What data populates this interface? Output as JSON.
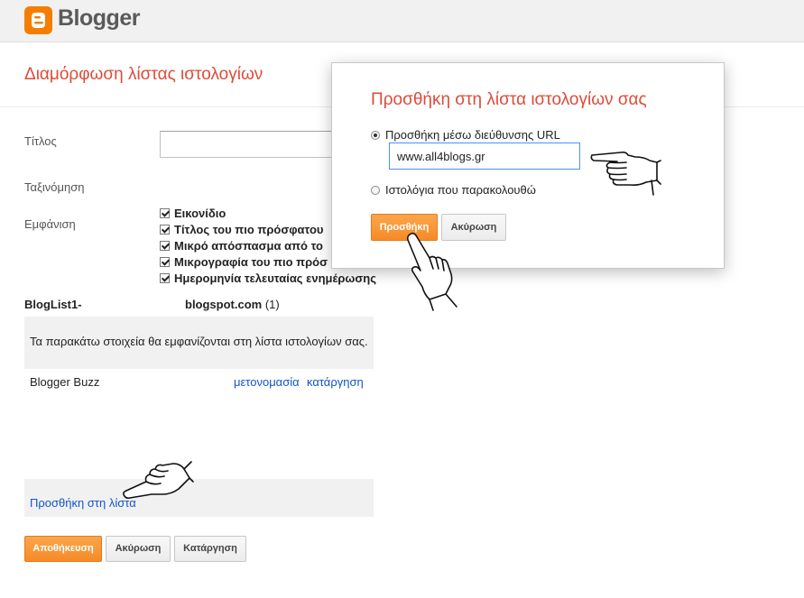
{
  "header": {
    "logo_text": "Blogger",
    "logo_icon": "blogger-logo-icon"
  },
  "page": {
    "title": "Διαμόρφωση λίστας ιστολογίων"
  },
  "form": {
    "title_label": "Τίτλος",
    "title_value": "",
    "sort_label": "Ταξινόμηση",
    "display_label": "Εμφάνιση",
    "display_options": [
      {
        "label": "Εικονίδιο",
        "checked": true
      },
      {
        "label": "Τίτλος του πιο πρόσφατου",
        "checked": true
      },
      {
        "label": "Μικρό απόσπασμα από το",
        "checked": true
      },
      {
        "label": "Μικρογραφία του πιο πρόσ",
        "checked": true
      },
      {
        "label": "Ημερομηνία τελευταίας ενημέρωσης",
        "checked": true
      }
    ]
  },
  "bloglist": {
    "id_label": "BlogList1-",
    "domain": "blogspot.com",
    "count": "(1)",
    "info_text": "Τα παρακάτω στοιχεία θα εμφανίζονται στη λίστα ιστολογίων σας.",
    "items": [
      {
        "name": "Blogger Buzz",
        "rename_label": "μετονομασία",
        "remove_label": "κατάργηση"
      }
    ],
    "add_link": "Προσθήκη στη λίστα"
  },
  "footer_buttons": {
    "save": "Αποθήκευση",
    "cancel": "Ακύρωση",
    "delete": "Κατάργηση"
  },
  "dialog": {
    "title": "Προσθήκη στη λίστα ιστολογίων σας",
    "option_url": "Προσθήκη μέσω διεύθυνσης URL",
    "url_value": "www.all4blogs.gr",
    "option_following": "Ιστολόγια που παρακολουθώ",
    "add_button": "Προσθήκη",
    "cancel_button": "Ακύρωση"
  },
  "colors": {
    "accent": "#dd4b39",
    "brand": "#f57d00",
    "link": "#1155cc",
    "button": "#f68b27"
  }
}
